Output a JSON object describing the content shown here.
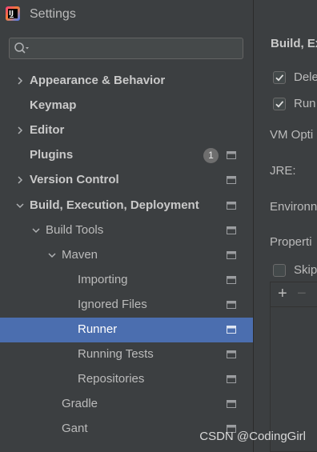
{
  "window": {
    "title": "Settings"
  },
  "search": {
    "value": "",
    "placeholder": ""
  },
  "tree": [
    {
      "label": "Appearance & Behavior",
      "bold": true,
      "expandable": true,
      "expanded": false
    },
    {
      "label": "Keymap",
      "bold": true,
      "expandable": false
    },
    {
      "label": "Editor",
      "bold": true,
      "expandable": true,
      "expanded": false
    },
    {
      "label": "Plugins",
      "bold": true,
      "expandable": false,
      "badge": "1"
    },
    {
      "label": "Version Control",
      "bold": true,
      "expandable": true,
      "expanded": false
    },
    {
      "label": "Build, Execution, Deployment",
      "bold": true,
      "expandable": true,
      "expanded": true
    },
    {
      "label": "Build Tools",
      "bold": false,
      "expandable": true,
      "expanded": true
    },
    {
      "label": "Maven",
      "bold": false,
      "expandable": true,
      "expanded": true
    },
    {
      "label": "Importing",
      "bold": false
    },
    {
      "label": "Ignored Files",
      "bold": false
    },
    {
      "label": "Runner",
      "bold": false,
      "selected": true
    },
    {
      "label": "Running Tests",
      "bold": false
    },
    {
      "label": "Repositories",
      "bold": false
    },
    {
      "label": "Gradle",
      "bold": false
    },
    {
      "label": "Gant",
      "bold": false
    }
  ],
  "content": {
    "breadcrumb": "Build, Ex",
    "options": [
      {
        "label": "Dele",
        "checked": true
      },
      {
        "label": "Run",
        "checked": true
      }
    ],
    "vm_options_label": "VM Opti",
    "jre_label": "JRE:",
    "environment_label": "Environn",
    "properties_label": "Properti",
    "skip_label": "Skip",
    "skip_checked": false,
    "add_button": "+",
    "remove_button": "−"
  },
  "watermark": "CSDN @CodingGirl",
  "colors": {
    "background": "#3c3f41",
    "selection": "#4b6eaf",
    "text": "#bbbbbb",
    "badge": "#6e6e6e"
  }
}
